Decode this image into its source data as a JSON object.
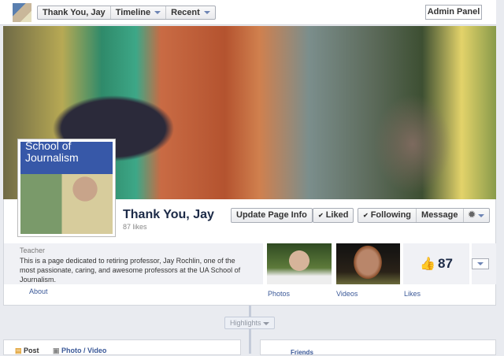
{
  "header": {
    "crumbs": [
      "Thank You, Jay",
      "Timeline",
      "Recent"
    ],
    "admin_panel": "Admin Panel"
  },
  "profile": {
    "picture_text": "School of Journalism",
    "name": "Thank You, Jay",
    "likes": "87 likes"
  },
  "actions": {
    "update": "Update Page Info",
    "liked": "Liked",
    "following": "Following",
    "message": "Message"
  },
  "about": {
    "category": "Teacher",
    "description": "This is a page dedicated to retiring professor, Jay Rochlin, one of the most passionate, caring, and awesome professors at the UA School of Journalism.",
    "link": "About"
  },
  "apps": {
    "photos": "Photos",
    "videos": "Videos",
    "likes": "Likes",
    "likes_count": "87"
  },
  "timeline": {
    "highlights": "Highlights",
    "post": "Post",
    "photo_video": "Photo / Video",
    "friends": "Friends"
  },
  "colors": {
    "link": "#3b5998",
    "title": "#1c2a47"
  }
}
